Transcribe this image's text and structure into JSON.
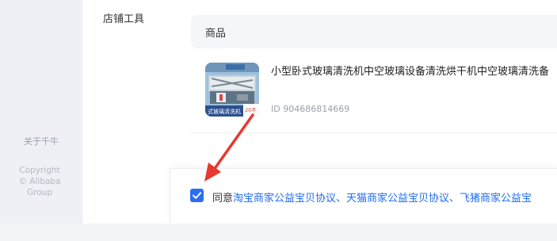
{
  "sidebar": {
    "about": "关于千牛",
    "copyright_line1": "Copyright",
    "copyright_line2": "© Alibaba",
    "copyright_line3": "Group"
  },
  "section": {
    "label": "店铺工具"
  },
  "table": {
    "header": "商品",
    "product": {
      "title": "小型卧式玻璃清洗机中空玻璃设备清洗烘干机中空玻璃清洗备",
      "id": "ID 904686814669",
      "thumbnail_caption": "式玻璃清洗机",
      "thumbnail_tag": "20不"
    }
  },
  "agreement": {
    "checked": true,
    "prefix": "同意",
    "links": "淘宝商家公益宝贝协议、天猫商家公益宝贝协议、飞猪商家公益宝"
  },
  "colors": {
    "accent": "#2b6ef5",
    "annotation_arrow": "#e8382f"
  }
}
